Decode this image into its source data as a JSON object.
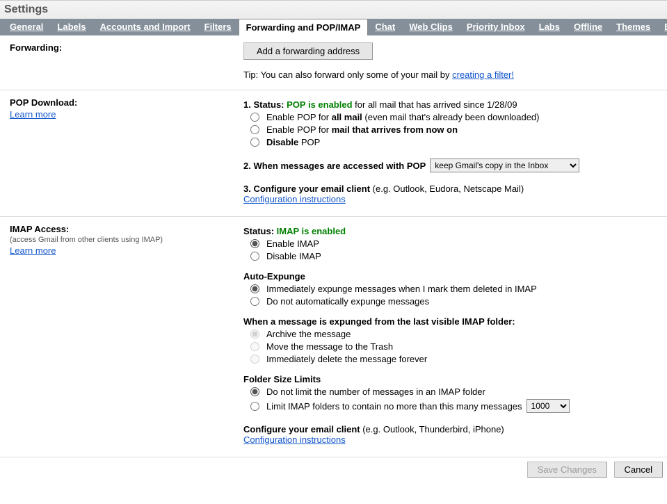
{
  "title": "Settings",
  "tabs": [
    "General",
    "Labels",
    "Accounts and Import",
    "Filters",
    "Forwarding and POP/IMAP",
    "Chat",
    "Web Clips",
    "Priority Inbox",
    "Labs",
    "Offline",
    "Themes",
    "Buzz"
  ],
  "activeTab": 4,
  "forwarding": {
    "label": "Forwarding:",
    "button": "Add a forwarding address",
    "tip_prefix": "Tip: You can also forward only some of your mail by ",
    "tip_link": "creating a filter!"
  },
  "pop": {
    "label": "POP Download:",
    "learn_more": "Learn more",
    "status_prefix": "1. Status: ",
    "status_value": "POP is enabled",
    "status_suffix": " for all mail that has arrived since 1/28/09",
    "opt1_a": "Enable POP for ",
    "opt1_b": "all mail",
    "opt1_c": " (even mail that's already been downloaded)",
    "opt2_a": "Enable POP for ",
    "opt2_b": "mail that arrives from now on",
    "opt3_a": "Disable",
    "opt3_b": " POP",
    "access_label": "2. When messages are accessed with POP",
    "access_options": [
      "keep Gmail's copy in the Inbox"
    ],
    "configure_a": "3. Configure your email client",
    "configure_b": " (e.g. Outlook, Eudora, Netscape Mail)",
    "configure_link": "Configuration instructions"
  },
  "imap": {
    "label": "IMAP Access:",
    "sub": "(access Gmail from other clients using IMAP)",
    "learn_more": "Learn more",
    "status_prefix": "Status: ",
    "status_value": "IMAP is enabled",
    "opt_enable": "Enable IMAP",
    "opt_disable": "Disable IMAP",
    "auto_expunge_label": "Auto-Expunge",
    "ae_opt1": "Immediately expunge messages when I mark them deleted in IMAP",
    "ae_opt2": "Do not automatically expunge messages",
    "expunged_label": "When a message is expunged from the last visible IMAP folder:",
    "ex_opt1": "Archive the message",
    "ex_opt2": "Move the message to the Trash",
    "ex_opt3": "Immediately delete the message forever",
    "folder_label": "Folder Size Limits",
    "fs_opt1": "Do not limit the number of messages in an IMAP folder",
    "fs_opt2": "Limit IMAP folders to contain no more than this many messages",
    "fs_options": [
      "1000"
    ],
    "configure_a": "Configure your email client",
    "configure_b": " (e.g. Outlook, Thunderbird, iPhone)",
    "configure_link": "Configuration instructions"
  },
  "footer": {
    "save": "Save Changes",
    "cancel": "Cancel"
  }
}
